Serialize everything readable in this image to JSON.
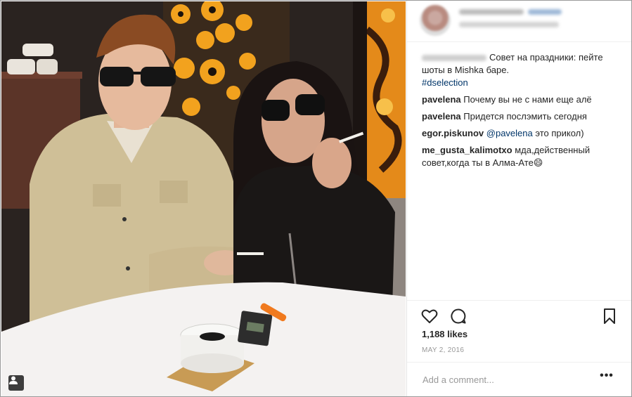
{
  "post": {
    "caption_text": "Совет на праздники: пейте шоты в Mishka баре.",
    "caption_hashtag": "#dselection",
    "comments": [
      {
        "user": "pavelena",
        "text": "Почему вы не с нами еще алё"
      },
      {
        "user": "pavelena",
        "text": "Придется послэмить сегодня"
      },
      {
        "user": "egor.piskunov",
        "mention": "@pavelena",
        "text": " это прикол)"
      },
      {
        "user": "me_gusta_kalimotxo",
        "text": "мда,действенный совет,когда ты в Алма-Ате😄"
      }
    ],
    "likes": "1,188 likes",
    "date": "MAY 2, 2016"
  },
  "comment_box": {
    "placeholder": "Add a comment...",
    "more": "•••"
  },
  "icons": {
    "like": "heart-icon",
    "comment": "comment-icon",
    "save": "bookmark-icon",
    "tag": "user-tag-icon"
  },
  "colors": {
    "link": "#003569",
    "text": "#262626",
    "muted": "#999999"
  }
}
